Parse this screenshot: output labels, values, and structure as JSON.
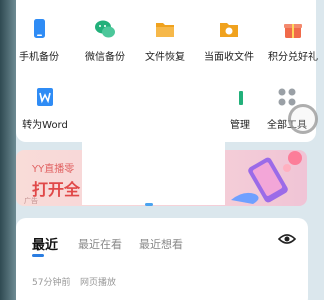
{
  "tools": [
    {
      "label": "手机备份",
      "icon": "phone-backup-icon",
      "color": "#2f8cf5"
    },
    {
      "label": "微信备份",
      "icon": "wechat-backup-icon",
      "color": "#22b07a"
    },
    {
      "label": "文件恢复",
      "icon": "file-restore-icon",
      "color": "#f0a21e"
    },
    {
      "label": "当面收文件",
      "icon": "face-to-face-icon",
      "color": "#f0a21e"
    },
    {
      "label": "积分兑好礼",
      "icon": "points-gift-icon",
      "color": "#f06a4a"
    },
    {
      "label": "转为Word",
      "icon": "word-convert-icon",
      "color": "#2f8cf5"
    },
    {
      "label": "管理",
      "icon": "manage-icon",
      "color": "#22b07a"
    },
    {
      "label": "全部工具",
      "icon": "all-tools-icon",
      "color": "#9aa0a6"
    }
  ],
  "banner": {
    "line1": "YY直播零",
    "line2": "打开全",
    "tag": "广告"
  },
  "recent": {
    "tabs": [
      "最近",
      "最近在看",
      "最近想看"
    ],
    "time": "57分钟前",
    "source": "网页播放"
  },
  "colors": {
    "accent": "#2a7de1",
    "banner_text": "#e04848"
  }
}
